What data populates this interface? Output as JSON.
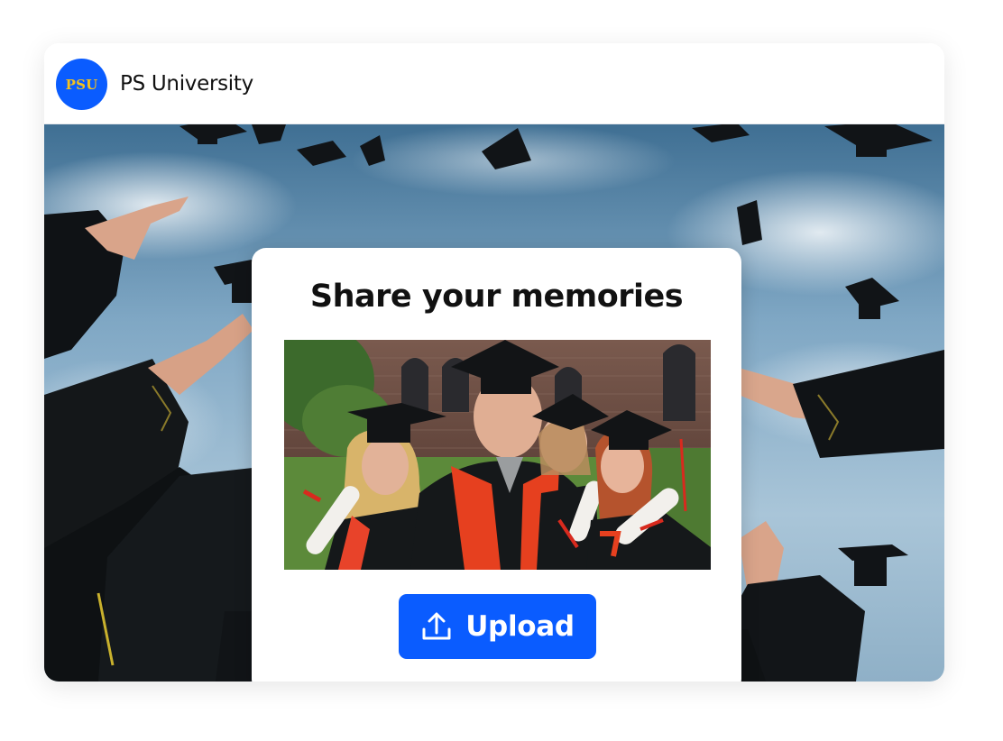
{
  "header": {
    "logo_text": "PSU",
    "brand_name": "PS University"
  },
  "hero": {
    "image_icon": "graduation-caps-thrown-photo"
  },
  "dialog": {
    "title": "Share your memories",
    "photo_icon": "graduates-selfie-photo",
    "upload_button": {
      "label": "Upload",
      "icon": "upload-icon"
    }
  },
  "colors": {
    "accent": "#0a5cff",
    "logo_text": "#f6c21c",
    "text": "#111111",
    "background": "#ffffff"
  }
}
